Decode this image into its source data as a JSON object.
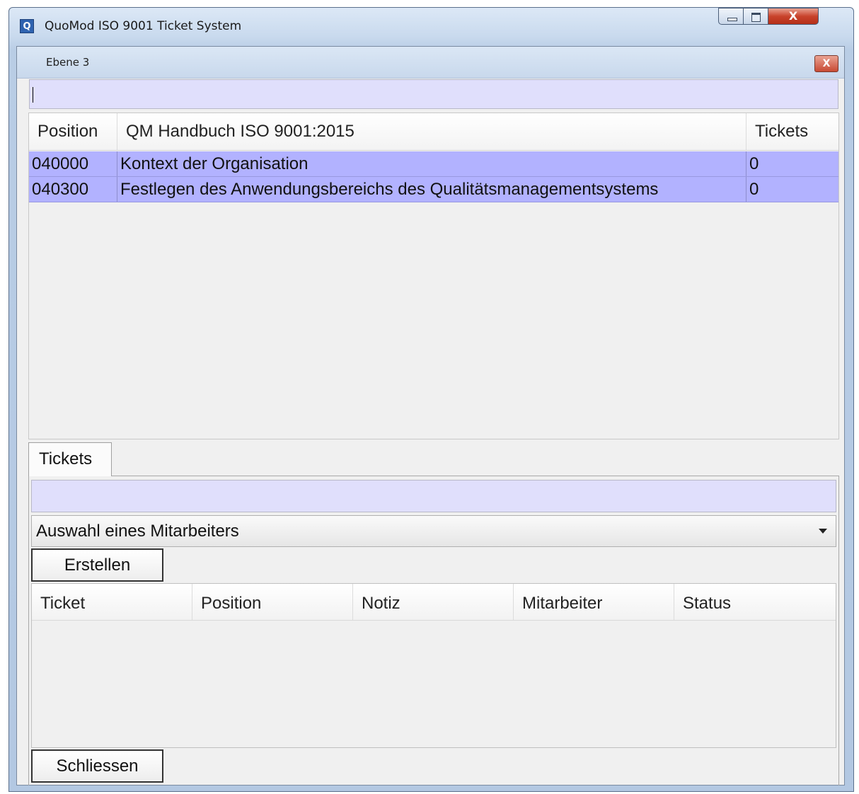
{
  "window": {
    "app_icon_letter": "Q",
    "title": "QuoMod ISO 9001 Ticket System",
    "close_glyph": "X"
  },
  "dialog": {
    "title": "Ebene 3",
    "close_glyph": "X"
  },
  "top_table": {
    "columns": [
      "Position",
      "QM Handbuch ISO 9001:2015",
      "Tickets"
    ],
    "rows": [
      {
        "position": "040000",
        "title": "Kontext der Organisation",
        "tickets": "0"
      },
      {
        "position": "040300",
        "title": "Festlegen des Anwendungsbereichs des Qualitätsmanagementsystems",
        "tickets": "0"
      }
    ],
    "selected_row_color": "#b2b2ff"
  },
  "tabs": {
    "active": "Tickets"
  },
  "employee_select": {
    "value": "Auswahl eines Mitarbeiters"
  },
  "buttons": {
    "create": "Erstellen",
    "close": "Schliessen"
  },
  "ticket_table": {
    "columns": [
      "Ticket",
      "Position",
      "Notiz",
      "Mitarbeiter",
      "Status"
    ]
  },
  "colors": {
    "input_background": "#e0dffc",
    "panel_background": "#f0f0f0"
  },
  "icons": [
    "app-logo-icon",
    "minimize-icon",
    "maximize-icon",
    "close-icon",
    "dropdown-arrow-icon"
  ]
}
